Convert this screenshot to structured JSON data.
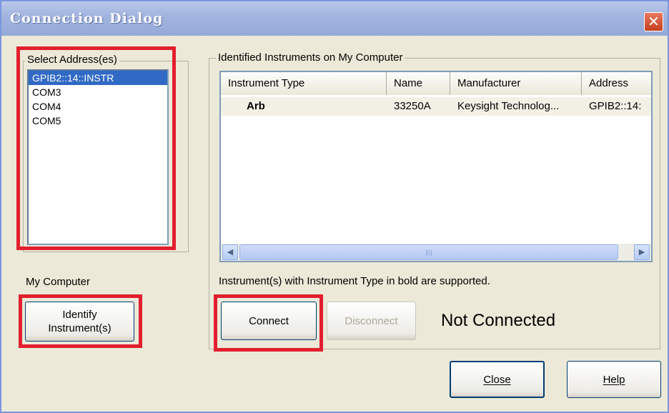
{
  "window": {
    "title": "Connection Dialog",
    "close_glyph": "✕"
  },
  "address_group": {
    "label": "Select Address(es)",
    "items": [
      "GPIB2::14::INSTR",
      "COM3",
      "COM4",
      "COM5"
    ],
    "selected_index": 0
  },
  "my_computer_label": "My Computer",
  "identify_button": {
    "line1": "Identify",
    "line2": "Instrument(s)"
  },
  "instruments_group": {
    "label": "Identified Instruments on My Computer",
    "columns": [
      "Instrument Type",
      "Name",
      "Manufacturer",
      "Address"
    ],
    "rows": [
      {
        "type": "Arb",
        "name": "33250A",
        "manufacturer": "Keysight Technolog...",
        "address": "GPIB2::14:"
      }
    ],
    "scroll_left_icon": "◀",
    "scroll_right_icon": "▶",
    "scroll_thumb_grip": "||||"
  },
  "note": "Instrument(s) with Instrument Type in bold are supported.",
  "connect_label": "Connect",
  "disconnect_label": "Disconnect",
  "status_text": "Not Connected",
  "close_label": "Close",
  "help_label": "Help",
  "colors": {
    "highlight_box": "#e21f2f",
    "selection": "#316ac5"
  }
}
